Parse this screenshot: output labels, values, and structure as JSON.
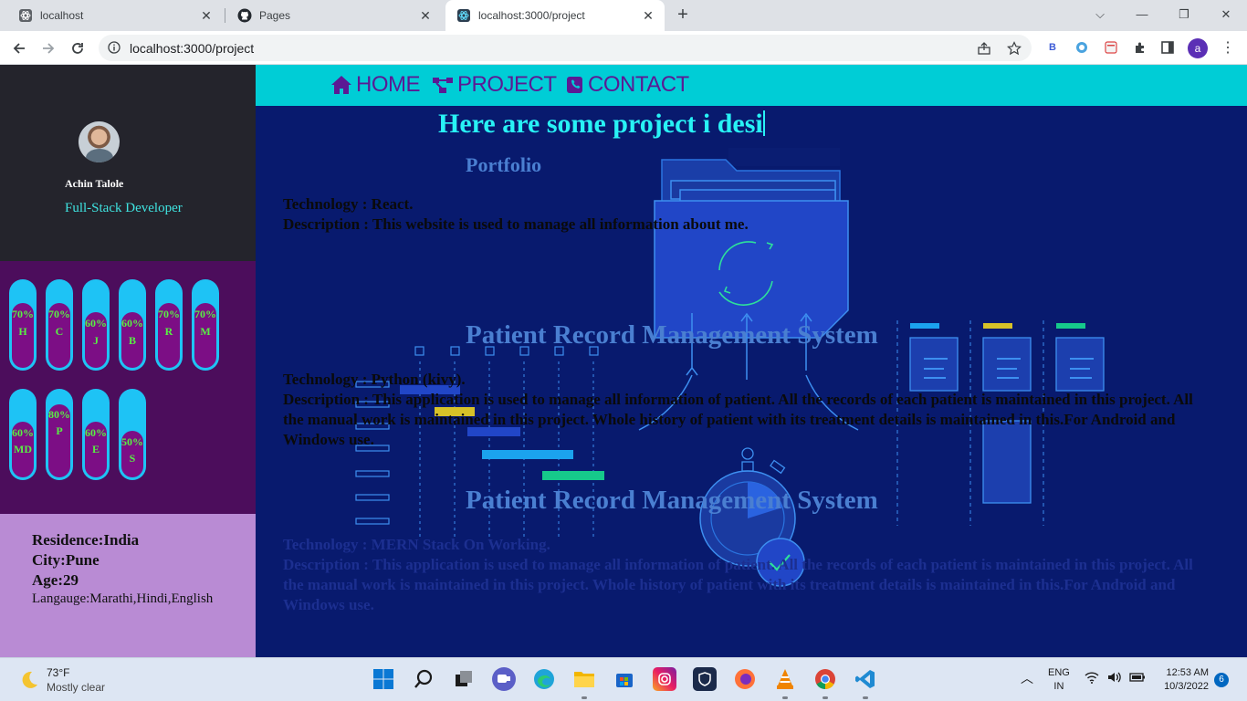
{
  "browser": {
    "tabs": [
      {
        "title": "localhost",
        "icon": "react-icon",
        "active": false
      },
      {
        "title": "Pages",
        "icon": "github-icon",
        "active": false
      },
      {
        "title": "localhost:3000/project",
        "icon": "react-icon",
        "active": true
      }
    ],
    "url": "localhost:3000/project",
    "profile_initial": "a"
  },
  "sidebar": {
    "name": "Achin Talole",
    "role": "Full-Stack Developer",
    "skills": [
      {
        "percent": "70%",
        "letter": "H",
        "level": 0.7
      },
      {
        "percent": "70%",
        "letter": "C",
        "level": 0.7
      },
      {
        "percent": "60%",
        "letter": "J",
        "level": 0.6
      },
      {
        "percent": "60%",
        "letter": "B",
        "level": 0.6
      },
      {
        "percent": "70%",
        "letter": "R",
        "level": 0.7
      },
      {
        "percent": "70%",
        "letter": "M",
        "level": 0.7
      },
      {
        "percent": "60%",
        "letter": "MD",
        "level": 0.6
      },
      {
        "percent": "80%",
        "letter": "P",
        "level": 0.8
      },
      {
        "percent": "60%",
        "letter": "E",
        "level": 0.6
      },
      {
        "percent": "50%",
        "letter": "S",
        "level": 0.5
      }
    ],
    "info": {
      "residence": "Residence:India",
      "city": "City:Pune",
      "age": "Age:29",
      "language": "Langauge:Marathi,Hindi,English"
    }
  },
  "nav": {
    "home": "HOME",
    "project": "PROJECT",
    "contact": "CONTACT"
  },
  "page": {
    "heading": "Here are some project i desi",
    "projects": [
      {
        "title": "Portfolio",
        "technology": "Technology : React.",
        "description": "Description : This website is used to manage all information about me."
      },
      {
        "title": "Patient Record Management System",
        "technology": "Technology : Python (kivy).",
        "description": "Description : This application is used to manage all information of patient. All the records of each patient is maintained in this project. All the manual work is maintained in this project. Whole history of patient with its treatment details is maintained in this.For Android and Windows use."
      },
      {
        "title": "Patient Record Management System",
        "technology": "Technology : MERN Stack On Working.",
        "description": "Description : This application is used to manage all information of patient. All the records of each patient is maintained in this project. All the manual work is maintained in this project. Whole history of patient with its treatment details is maintained in this.For Android and Windows use."
      }
    ]
  },
  "taskbar": {
    "weather_temp": "73°F",
    "weather_desc": "Mostly clear",
    "lang_top": "ENG",
    "lang_bottom": "IN",
    "time": "12:53 AM",
    "date": "10/3/2022",
    "notifications": "6"
  },
  "colors": {
    "nav_bg": "#00cdd6",
    "main_bg": "#081a6e",
    "heading": "#28f2f5",
    "project_title": "#4a7fd1",
    "skills_bg": "#4c0d5c",
    "info_bg": "#b98bd4"
  }
}
